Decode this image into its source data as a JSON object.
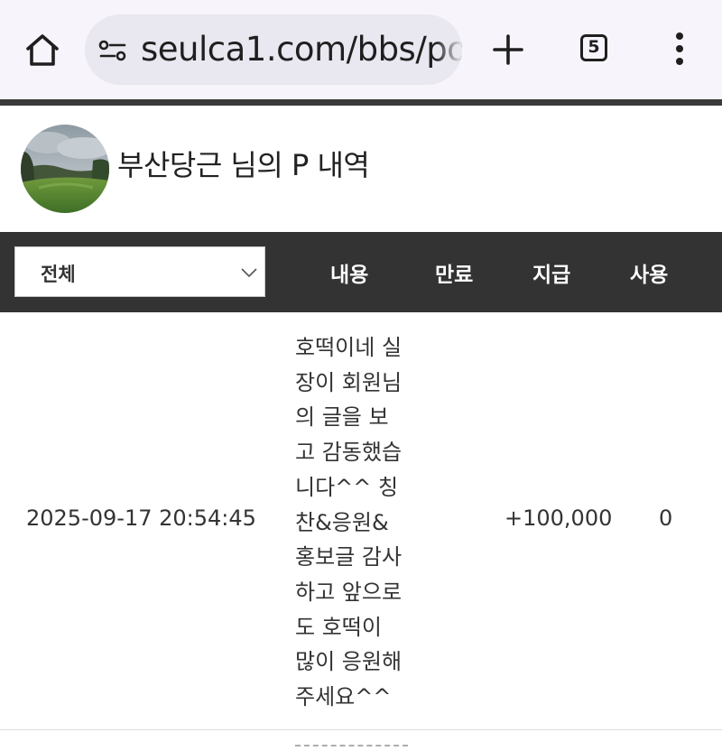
{
  "browser": {
    "url": "seulca1.com/bbs/po",
    "tab_count": "5"
  },
  "profile": {
    "title": "부산당근 님의 P 내역"
  },
  "table": {
    "filter_value": "전체",
    "headers": [
      "내용",
      "만료",
      "지급",
      "사용"
    ],
    "rows": [
      {
        "date": "2025-09-17 20:54:45",
        "content_lines": [
          "호떡이네 실",
          "장이 회원님",
          "의 글을 보",
          "고 감동했습",
          "니다^^ 칭",
          "찬&응원&",
          "홍보글 감사",
          "하고 앞으로",
          "도 호떡이",
          "많이 응원해",
          "주세요^^"
        ],
        "expire": "",
        "give": "+100,000",
        "use": "0"
      }
    ]
  },
  "colors": {
    "header_bg": "#333333",
    "chrome_bg": "#f7f5fb",
    "urlbar_bg": "#e9e7ef"
  },
  "icons": {
    "home": "home-icon",
    "site_info": "tune-icon",
    "new_tab": "plus-icon",
    "tabs": "tab-switcher-icon",
    "menu": "more-vertical-icon",
    "dropdown": "chevron-down-icon"
  }
}
